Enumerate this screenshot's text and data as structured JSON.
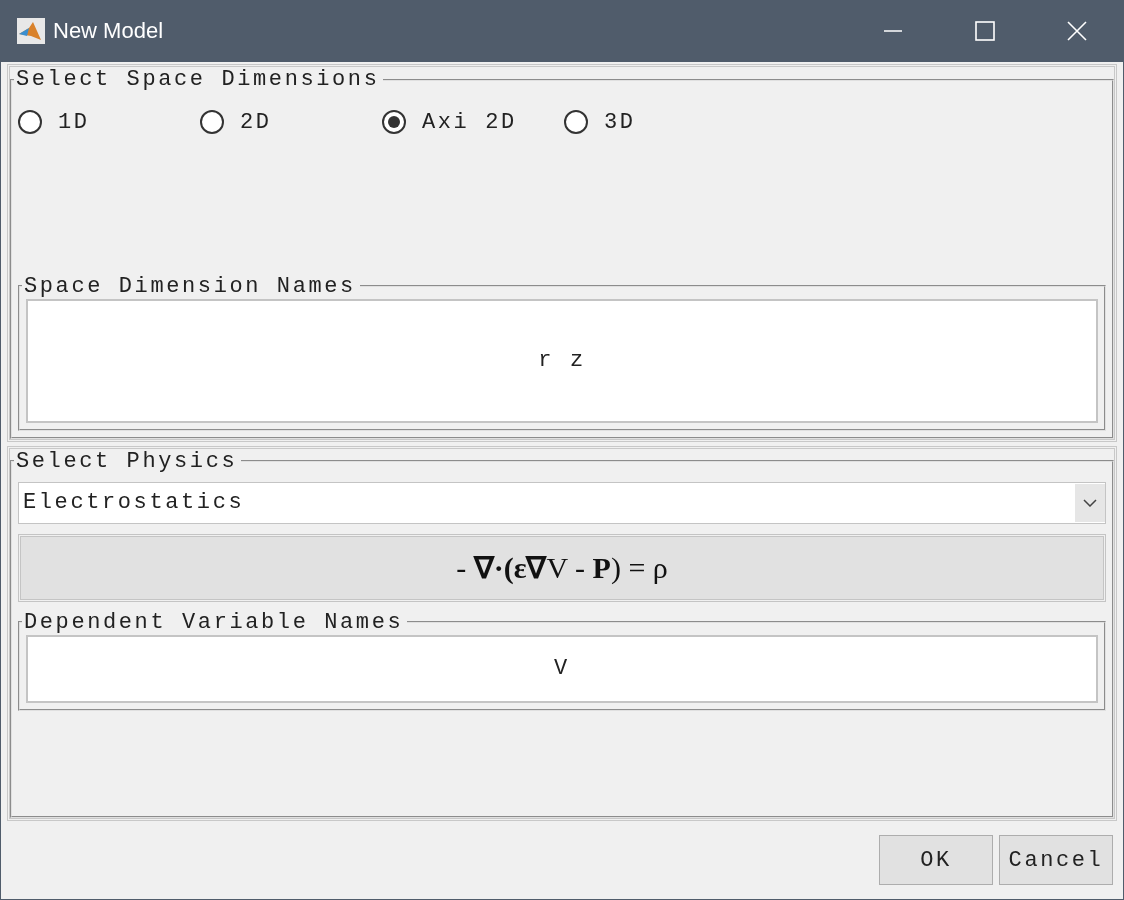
{
  "window": {
    "title": "New Model"
  },
  "space_dimensions": {
    "title": "Select Space Dimensions",
    "options": [
      {
        "label": "1D",
        "selected": false
      },
      {
        "label": "2D",
        "selected": false
      },
      {
        "label": "Axi 2D",
        "selected": true
      },
      {
        "label": "3D",
        "selected": false
      }
    ]
  },
  "space_dimension_names": {
    "title": "Space Dimension Names",
    "value": "r z"
  },
  "physics": {
    "title": "Select Physics",
    "value": "Electrostatics",
    "equation": "- **∇·(ε∇**V - **P**) = ρ"
  },
  "dependent_variable_names": {
    "title": "Dependent Variable Names",
    "value": "V"
  },
  "buttons": [
    "OK",
    "Cancel"
  ]
}
